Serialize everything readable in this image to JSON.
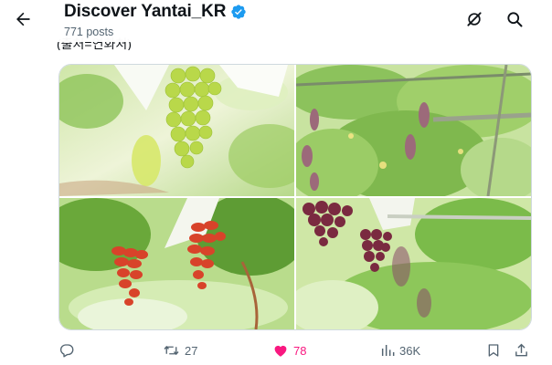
{
  "header": {
    "title": "Discover Yantai_KR",
    "subtitle": "771 posts"
  },
  "post": {
    "cut_text": "(출처=연화처)"
  },
  "actions": {
    "reply_count": "",
    "repost_count": "27",
    "like_count": "78",
    "views_count": "36K"
  },
  "icons": {
    "back": "arrow-left-icon",
    "verified": "verified-badge-icon",
    "grok": "grok-icon",
    "search": "search-icon",
    "reply": "reply-icon",
    "repost": "repost-icon",
    "like": "heart-icon",
    "views": "views-icon",
    "bookmark": "bookmark-icon",
    "share": "share-icon"
  },
  "colors": {
    "accent": "#1d9bf0",
    "like": "#f91880",
    "muted": "#536471",
    "text": "#0f1419"
  },
  "photos": [
    {
      "subject": "green grapes"
    },
    {
      "subject": "grape vineyard"
    },
    {
      "subject": "red grapes"
    },
    {
      "subject": "purple grapes"
    }
  ]
}
